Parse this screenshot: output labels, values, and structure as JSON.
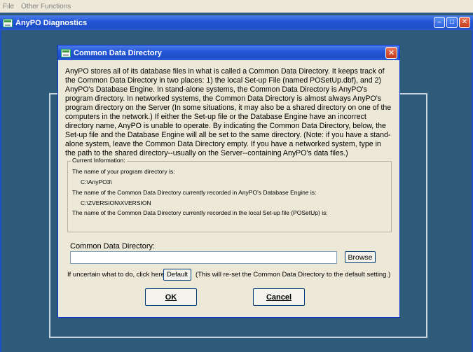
{
  "menubar": {
    "items": [
      "File",
      "Other Functions"
    ]
  },
  "main_window": {
    "title": "AnyPO Diagnostics"
  },
  "dialog": {
    "title": "Common Data Directory",
    "intro": "AnyPO stores all of its database files in what is called a Common Data Directory.  It keeps track of the Common Data Directory in two places:  1) the local Set-up File (named POSetUp.dbf), and 2) AnyPO's Database Engine.  In stand-alone systems, the Common Data Directory is AnyPO's program directory.  In networked systems, the Common Data Directory is almost always AnyPO's program directory on the Server  (In some situations, it may also be a shared directory on one of the computers in the network.)  If either the Set-up file or the Database Engine have an incorrect directory name, AnyPO is unable to operate.  By indicating the Common Data Directory, below, the Set-up file and the Database Engine will all be set to the same directory.  (Note: if you have a stand-alone system, leave the Common Data Directory empty.  If you have a networked system, type in the path to the shared directory--usually on the Server--containing AnyPO's data files.)",
    "current_info": {
      "legend": "Current Information:",
      "program_dir_label": "The name of your program directory is:",
      "program_dir_value": "C:\\AnyPO3\\",
      "engine_label": "The name of the Common Data Directory currently recorded in AnyPO's Database Engine is:",
      "engine_value": "C:\\ZVERSION\\XVERSION",
      "setup_label": "The name of the Common Data Directory currently recorded in the local Set-up file (POSetUp) is:",
      "setup_value": ""
    },
    "cdd_label": "Common Data Directory:",
    "cdd_value": "",
    "browse_label": "Browse",
    "uncertain_text": "If uncertain what to do, click here:",
    "default_label": "Default",
    "reset_note": "(This will re-set the Common Data Directory to the default setting.)",
    "ok_label": "OK",
    "cancel_label": "Cancel"
  }
}
